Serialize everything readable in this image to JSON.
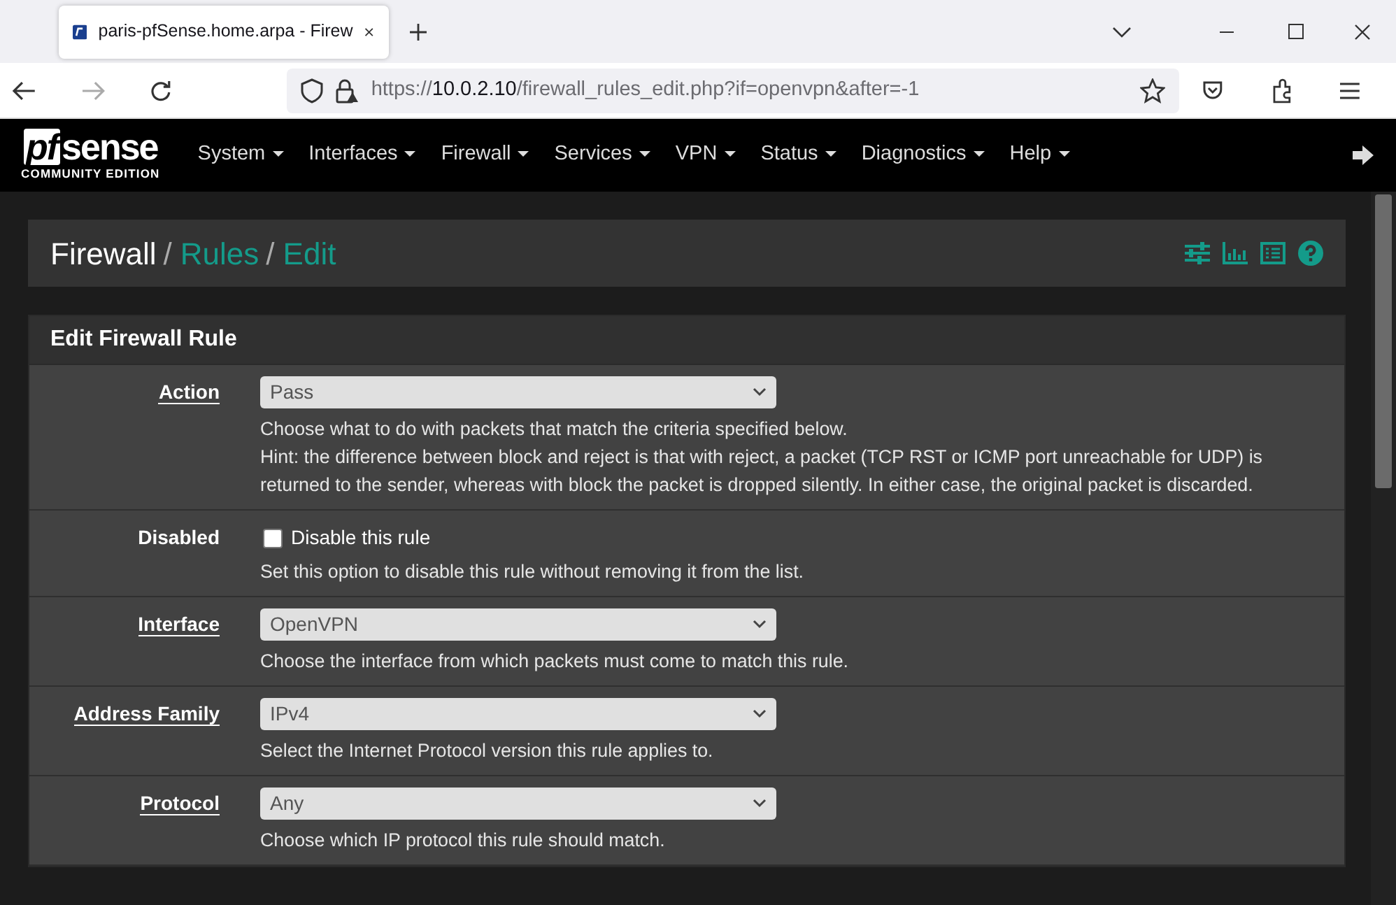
{
  "browser": {
    "tab_title": "paris-pfSense.home.arpa - Firew",
    "url_scheme": "https://",
    "url_host": "10.0.2.10",
    "url_path": "/firewall_rules_edit.php?if=openvpn&after=-1"
  },
  "logo": {
    "text_pf": "pf",
    "text_sense": "sense",
    "edition": "COMMUNITY EDITION"
  },
  "menu": [
    {
      "label": "System"
    },
    {
      "label": "Interfaces"
    },
    {
      "label": "Firewall"
    },
    {
      "label": "Services"
    },
    {
      "label": "VPN"
    },
    {
      "label": "Status"
    },
    {
      "label": "Diagnostics"
    },
    {
      "label": "Help"
    }
  ],
  "breadcrumb": {
    "separator": "/",
    "items": [
      {
        "label": "Firewall",
        "link": false
      },
      {
        "label": "Rules",
        "link": true
      },
      {
        "label": "Edit",
        "link": true
      }
    ]
  },
  "panel": {
    "title": "Edit Firewall Rule",
    "rows": [
      {
        "kind": "select",
        "label": "Action",
        "underlined": true,
        "value": "Pass",
        "help": [
          "Choose what to do with packets that match the criteria specified below.",
          "Hint: the difference between block and reject is that with reject, a packet (TCP RST or ICMP port unreachable for UDP) is",
          "returned to the sender, whereas with block the packet is dropped silently. In either case, the original packet is discarded."
        ]
      },
      {
        "kind": "checkbox",
        "label": "Disabled",
        "underlined": false,
        "checked": false,
        "option": "Disable this rule",
        "help": [
          "Set this option to disable this rule without removing it from the list."
        ]
      },
      {
        "kind": "select",
        "label": "Interface",
        "underlined": true,
        "value": "OpenVPN",
        "help": [
          "Choose the interface from which packets must come to match this rule."
        ]
      },
      {
        "kind": "select",
        "label": "Address Family",
        "underlined": true,
        "value": "IPv4",
        "help": [
          "Select the Internet Protocol version this rule applies to."
        ]
      },
      {
        "kind": "select",
        "label": "Protocol",
        "underlined": true,
        "value": "Any",
        "help": [
          "Choose which IP protocol this rule should match."
        ]
      }
    ]
  }
}
